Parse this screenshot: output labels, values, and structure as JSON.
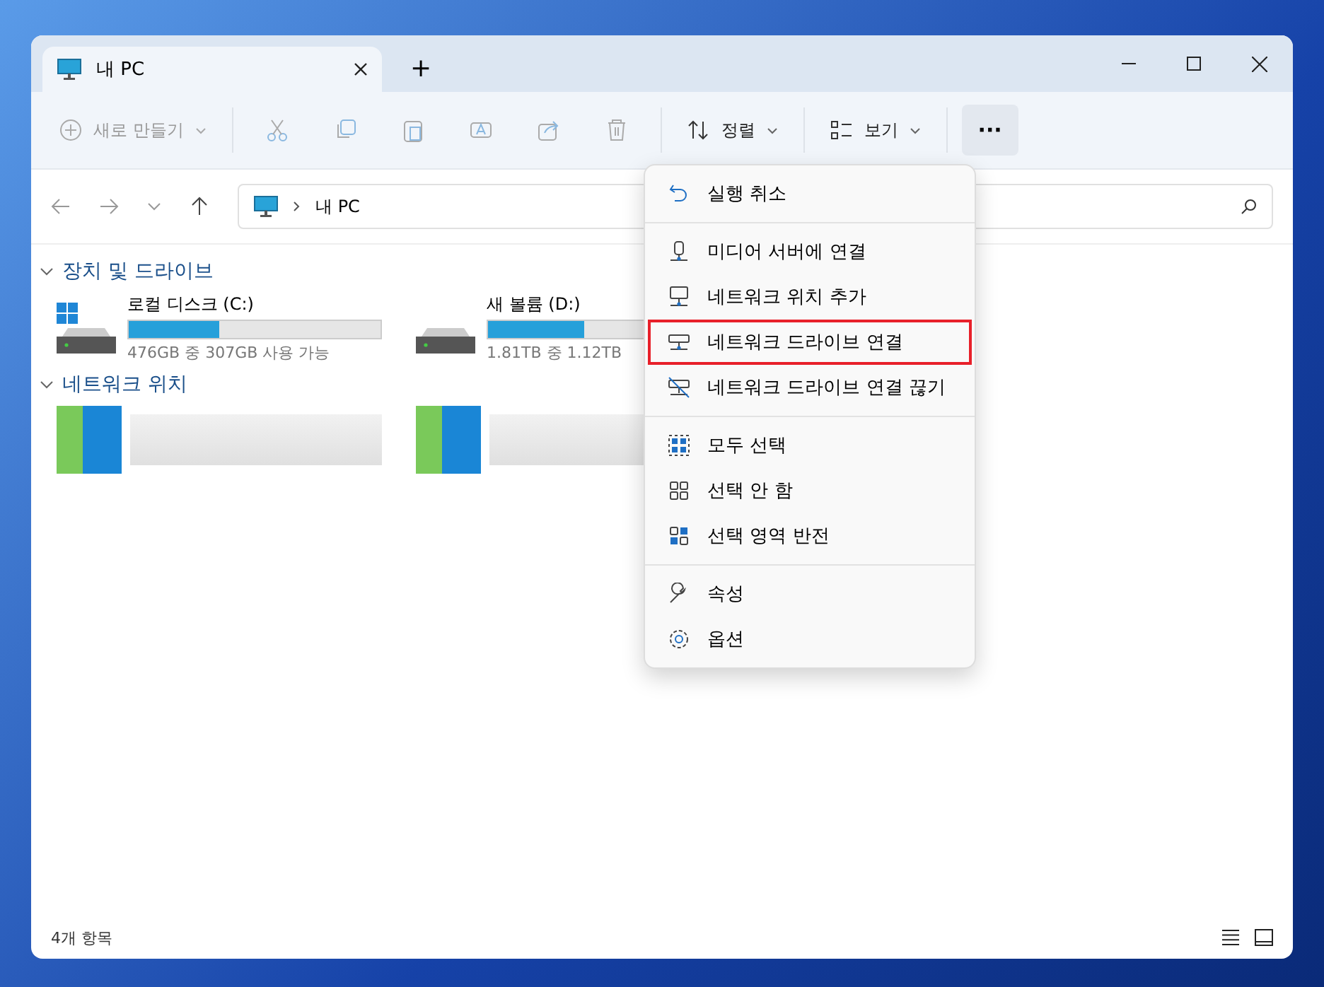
{
  "window": {
    "tab_title": "내 PC",
    "new_tab": "+"
  },
  "toolbar": {
    "new_label": "새로 만들기",
    "actions": [
      {
        "kind": "cut"
      },
      {
        "kind": "copy"
      },
      {
        "kind": "paste"
      },
      {
        "kind": "rename"
      },
      {
        "kind": "share"
      },
      {
        "kind": "delete"
      }
    ],
    "sort_label": "정렬",
    "view_label": "보기",
    "more": "···"
  },
  "address": {
    "path": "내 PC"
  },
  "sections": [
    {
      "title": "장치 및 드라이브",
      "expanded": true,
      "drives": [
        {
          "name": "로컬 디스크 (C:)",
          "system": true,
          "level": 0.36,
          "info": "476GB 중 307GB 사용 가능"
        },
        {
          "name": "새 볼륨 (D:)",
          "system": false,
          "level": 0.38,
          "info": "1.81TB 중 1.12TB"
        }
      ]
    },
    {
      "title": "네트워크 위치",
      "expanded": true,
      "kind": "network"
    }
  ],
  "status_bar": {
    "count": "4개 항목"
  },
  "menu": {
    "groups": [
      [
        {
          "kind": "undo",
          "label": "실행 취소",
          "highlighted": false
        }
      ],
      [
        {
          "kind": "media",
          "label": "미디어 서버에 연결",
          "highlighted": false
        },
        {
          "kind": "netloc",
          "label": "네트워크 위치 추가",
          "highlighted": false
        },
        {
          "kind": "map",
          "label": "네트워크 드라이브 연결",
          "highlighted": true
        },
        {
          "kind": "unmap",
          "label": "네트워크 드라이브 연결 끊기",
          "highlighted": false
        }
      ],
      [
        {
          "kind": "selall",
          "label": "모두 선택",
          "highlighted": false
        },
        {
          "kind": "selnone",
          "label": "선택 안 함",
          "highlighted": false
        },
        {
          "kind": "selinv",
          "label": "선택 영역 반전",
          "highlighted": false
        }
      ],
      [
        {
          "kind": "props",
          "label": "속성",
          "highlighted": false
        },
        {
          "kind": "options",
          "label": "옵션",
          "highlighted": false
        }
      ]
    ]
  }
}
